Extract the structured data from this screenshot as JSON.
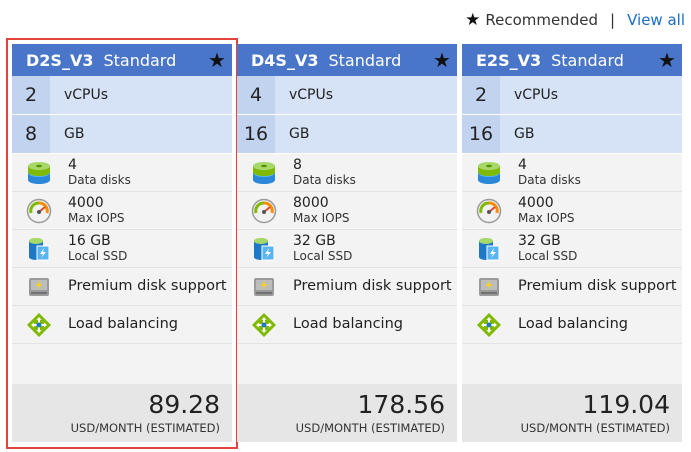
{
  "header": {
    "recommended_label": "Recommended",
    "view_all_label": "View all"
  },
  "cards": [
    {
      "sku": "D2S_V3",
      "tier": "Standard",
      "vcpus": "2",
      "vcpus_label": "vCPUs",
      "ram": "8",
      "ram_label": "GB",
      "data_disks": "4",
      "data_disks_label": "Data disks",
      "max_iops": "4000",
      "max_iops_label": "Max IOPS",
      "local_ssd": "16 GB",
      "local_ssd_label": "Local SSD",
      "premium_disk": "Premium disk support",
      "load_balancing": "Load balancing",
      "price": "89.28",
      "price_unit": "USD/MONTH (ESTIMATED)"
    },
    {
      "sku": "D4S_V3",
      "tier": "Standard",
      "vcpus": "4",
      "vcpus_label": "vCPUs",
      "ram": "16",
      "ram_label": "GB",
      "data_disks": "8",
      "data_disks_label": "Data disks",
      "max_iops": "8000",
      "max_iops_label": "Max IOPS",
      "local_ssd": "32 GB",
      "local_ssd_label": "Local SSD",
      "premium_disk": "Premium disk support",
      "load_balancing": "Load balancing",
      "price": "178.56",
      "price_unit": "USD/MONTH (ESTIMATED)"
    },
    {
      "sku": "E2S_V3",
      "tier": "Standard",
      "vcpus": "2",
      "vcpus_label": "vCPUs",
      "ram": "16",
      "ram_label": "GB",
      "data_disks": "4",
      "data_disks_label": "Data disks",
      "max_iops": "4000",
      "max_iops_label": "Max IOPS",
      "local_ssd": "32 GB",
      "local_ssd_label": "Local SSD",
      "premium_disk": "Premium disk support",
      "load_balancing": "Load balancing",
      "price": "119.04",
      "price_unit": "USD/MONTH (ESTIMATED)"
    }
  ],
  "colors": {
    "header_blue": "#4a76c9",
    "spec_blue": "#d6e2f6",
    "selection_red": "#e0443c",
    "link_blue": "#1a6dc7"
  }
}
